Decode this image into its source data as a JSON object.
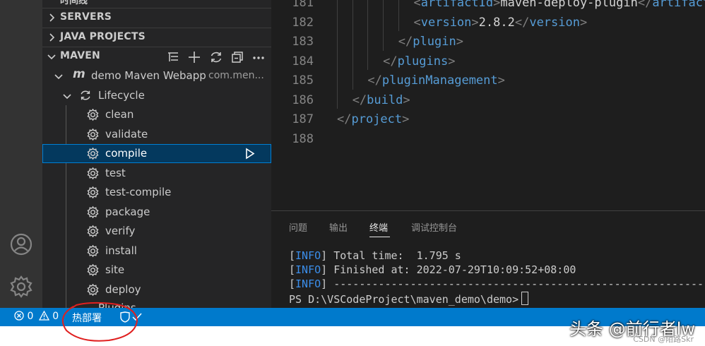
{
  "sidebar": {
    "partial_top": "时间线",
    "sections": {
      "servers": "SERVERS",
      "java_projects": "JAVA PROJECTS",
      "maven": "MAVEN"
    },
    "project": {
      "name": "demo Maven Webapp",
      "group": "com.men..."
    },
    "lifecycle": {
      "label": "Lifecycle",
      "items": [
        "clean",
        "validate",
        "compile",
        "test",
        "test-compile",
        "package",
        "verify",
        "install",
        "site",
        "deploy"
      ]
    },
    "partial_bottom": "Plugins",
    "maven_toolbar_icons": [
      "collapse-list-icon",
      "add-icon",
      "refresh-icon",
      "collapse-all-icon",
      "more-icon"
    ]
  },
  "editor": {
    "lines": [
      {
        "num": "181",
        "indent": 5,
        "open": "<",
        "tag": "artifactId",
        "close": ">",
        "text": "maven-deploy-plugin",
        "end": "</artifactId>"
      },
      {
        "num": "182",
        "indent": 5,
        "open": "<",
        "tag": "version",
        "close": ">",
        "text": "2.8.2",
        "end": "</version>"
      },
      {
        "num": "183",
        "indent": 4,
        "open": "</",
        "tag": "plugin",
        "close": ">",
        "text": "",
        "end": ""
      },
      {
        "num": "184",
        "indent": 3,
        "open": "</",
        "tag": "plugins",
        "close": ">",
        "text": "",
        "end": ""
      },
      {
        "num": "185",
        "indent": 2,
        "open": "</",
        "tag": "pluginManagement",
        "close": ">",
        "text": "",
        "end": ""
      },
      {
        "num": "186",
        "indent": 1,
        "open": "</",
        "tag": "build",
        "close": ">",
        "text": "",
        "end": ""
      },
      {
        "num": "187",
        "indent": 0,
        "open": "</",
        "tag": "project",
        "close": ">",
        "text": "",
        "end": ""
      },
      {
        "num": "188",
        "indent": 0,
        "open": "",
        "tag": "",
        "close": "",
        "text": "",
        "end": ""
      }
    ]
  },
  "panel": {
    "tabs": [
      "问题",
      "输出",
      "终端",
      "调试控制台"
    ],
    "active_tab": "终端",
    "terminal": [
      {
        "prefix": "[",
        "level": "INFO",
        "suffix": "] Total time:  1.795 s"
      },
      {
        "prefix": "[",
        "level": "INFO",
        "suffix": "] Finished at: 2022-07-29T10:09:52+08:00"
      },
      {
        "prefix": "[",
        "level": "INFO",
        "suffix": "] ------------------------------------------------------------------------"
      }
    ],
    "prompt": "PS D:\\VSCodeProject\\maven_demo\\demo>"
  },
  "statusbar": {
    "errors": "0",
    "warnings": "0",
    "hot_deploy": "热部署"
  },
  "watermark": {
    "text": "头条 @前行者lw",
    "csdn": "CSDN @陌路Skr"
  },
  "colors": {
    "accent": "#007acc",
    "selection": "#04395e",
    "selection_border": "#007fd4",
    "xml_tag": "#569cd6",
    "annotation": "#e02020"
  }
}
